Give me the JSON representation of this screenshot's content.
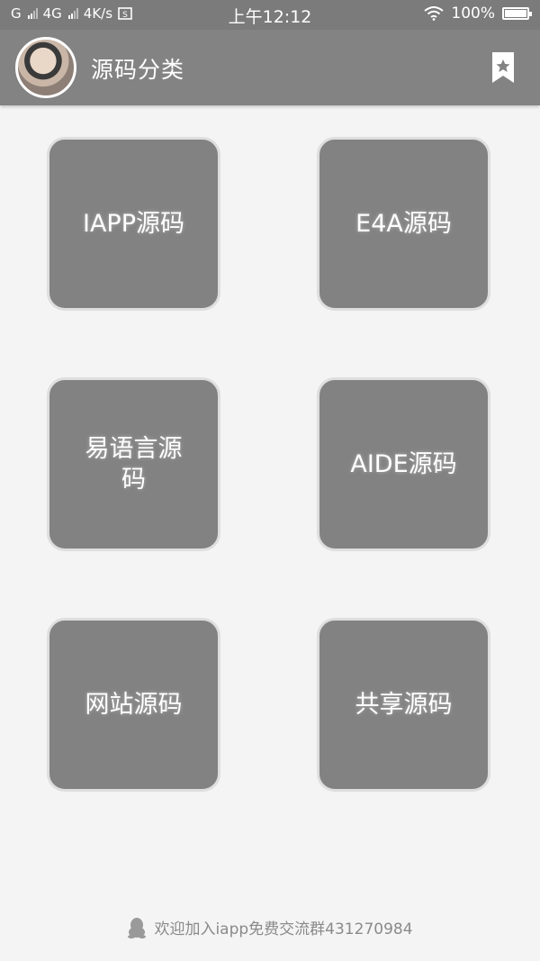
{
  "status_bar": {
    "signal_1": "G",
    "signal_2": "4G",
    "net_speed": "4K/s",
    "time": "上午12:12",
    "battery": "100%"
  },
  "header": {
    "title": "源码分类"
  },
  "tiles": [
    {
      "label": "IAPP源码"
    },
    {
      "label": "E4A源码"
    },
    {
      "label": "易语言源码"
    },
    {
      "label": "AIDE源码"
    },
    {
      "label": "网站源码"
    },
    {
      "label": "共享源码"
    }
  ],
  "footer": {
    "text": "欢迎加入iapp免费交流群431270984"
  },
  "icons": {
    "header_right": "bookmark-star-icon",
    "footer_left": "qq-penguin-icon",
    "status": [
      "signal-icon",
      "wifi-icon",
      "battery-icon",
      "screenshot-icon"
    ]
  },
  "colors": {
    "header_bg": "#838383",
    "status_bg": "#7b7b7b",
    "tile_bg": "#828282",
    "page_bg": "#f4f4f4"
  }
}
